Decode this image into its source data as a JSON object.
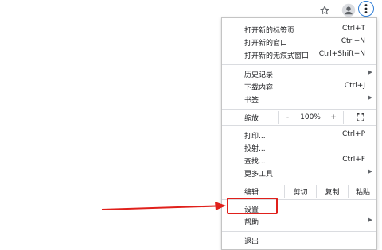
{
  "menu": {
    "new_tab": {
      "label": "打开新的标签页",
      "shortcut": "Ctrl+T"
    },
    "new_window": {
      "label": "打开新的窗口",
      "shortcut": "Ctrl+N"
    },
    "incognito": {
      "label": "打开新的无痕式窗口",
      "shortcut": "Ctrl+Shift+N"
    },
    "history": {
      "label": "历史记录"
    },
    "downloads": {
      "label": "下载内容",
      "shortcut": "Ctrl+J"
    },
    "bookmarks": {
      "label": "书签"
    },
    "zoom": {
      "label": "缩放",
      "minus": "-",
      "value": "100%",
      "plus": "+"
    },
    "print": {
      "label": "打印...",
      "shortcut": "Ctrl+P"
    },
    "cast": {
      "label": "投射..."
    },
    "find": {
      "label": "查找...",
      "shortcut": "Ctrl+F"
    },
    "more_tools": {
      "label": "更多工具"
    },
    "edit": {
      "label": "编辑",
      "cut": "剪切",
      "copy": "复制",
      "paste": "粘贴"
    },
    "settings": {
      "label": "设置"
    },
    "help": {
      "label": "帮助"
    },
    "exit": {
      "label": "退出"
    }
  },
  "icons": {
    "star": "star-icon",
    "profile": "profile-icon",
    "menu": "more-vert-icon",
    "fullscreen": "fullscreen-icon",
    "submenu": "arrow-right-icon"
  },
  "colors": {
    "annotation": "#e0201b",
    "focus_ring": "#2e7dd6"
  }
}
